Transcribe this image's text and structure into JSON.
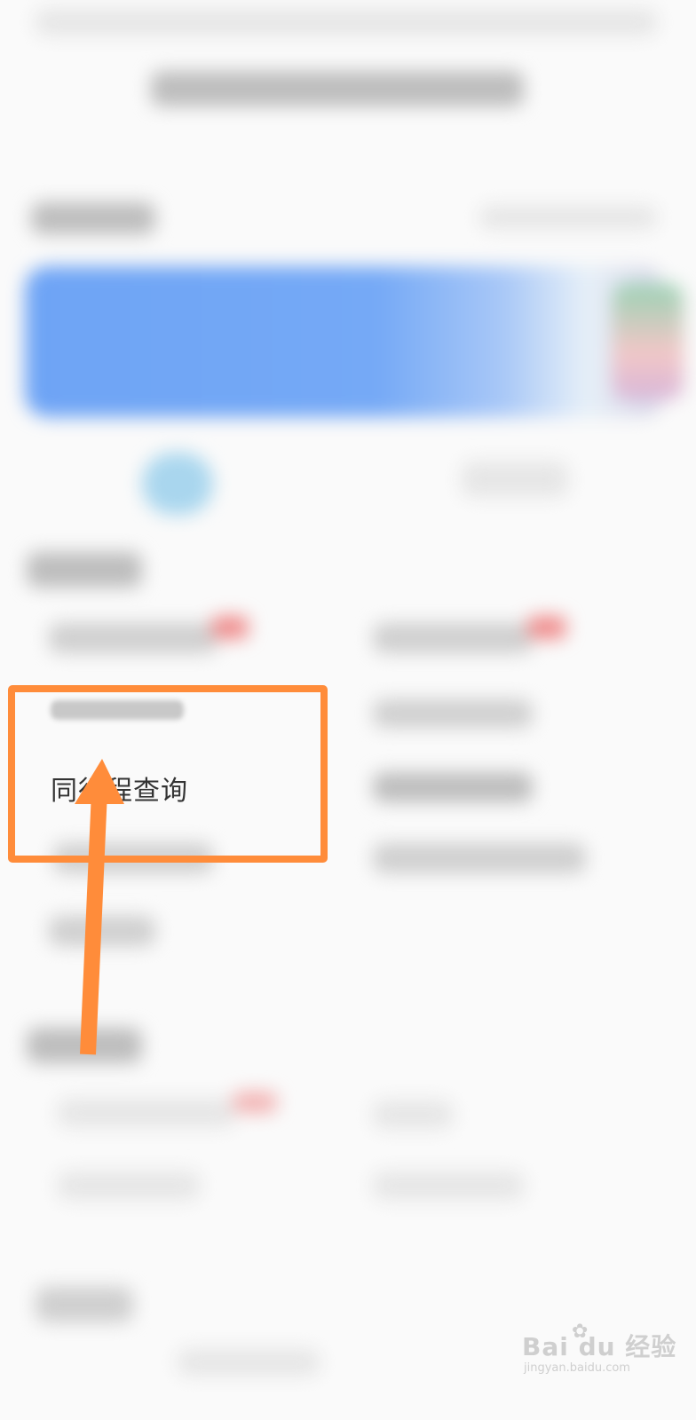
{
  "menu": {
    "highlighted_item": "同行程查询"
  },
  "watermark": {
    "brand": "Bai  du 经验",
    "url": "jingyan.baidu.com",
    "icon": "paw-icon"
  },
  "colors": {
    "highlight": "#ff8c3a",
    "banner_blue": "#6ea4f5",
    "background": "#fafafa"
  }
}
